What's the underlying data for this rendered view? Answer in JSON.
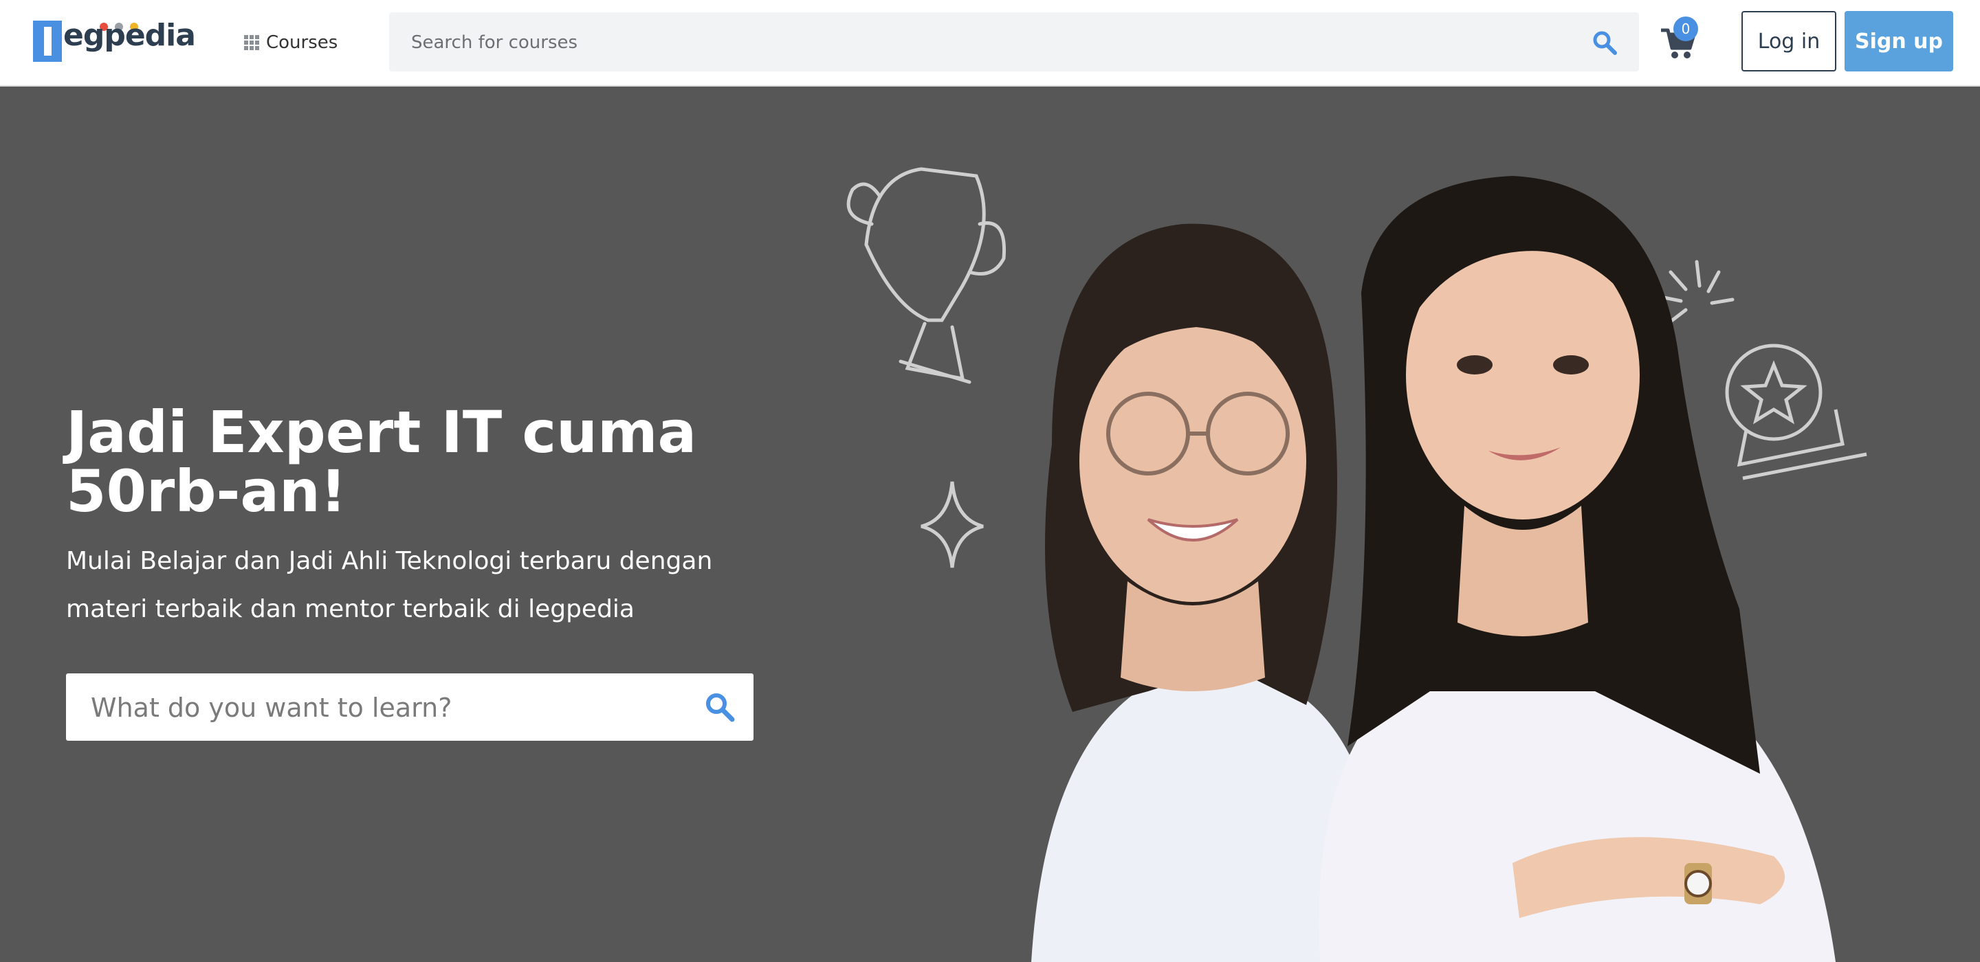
{
  "header": {
    "logo_text": "egpedia",
    "logo_dot_colors": [
      "#e84c3d",
      "#9aa0a6",
      "#f0b429"
    ],
    "courses_label": "Courses",
    "search_placeholder": "Search for courses",
    "cart_count": "0",
    "login_label": "Log in",
    "signup_label": "Sign up"
  },
  "hero": {
    "title": "Jadi Expert IT cuma 50rb-an!",
    "subtitle": "Mulai Belajar dan Jadi Ahli Teknologi terbaru dengan materi terbaik dan mentor terbaik di legpedia",
    "search_placeholder": "What do you want to learn?"
  },
  "icons": {
    "header_search": "search-icon",
    "courses": "grid-icon",
    "cart": "cart-icon",
    "hero_search": "search-icon",
    "doodles": [
      "trophy-icon",
      "sparkle-icon",
      "burst-icon",
      "star-medal-icon"
    ]
  },
  "colors": {
    "brand_blue": "#4a90e2",
    "signup_blue": "#5aa2dd",
    "hero_bg": "#575757",
    "logo_navy": "#2d3e50"
  }
}
